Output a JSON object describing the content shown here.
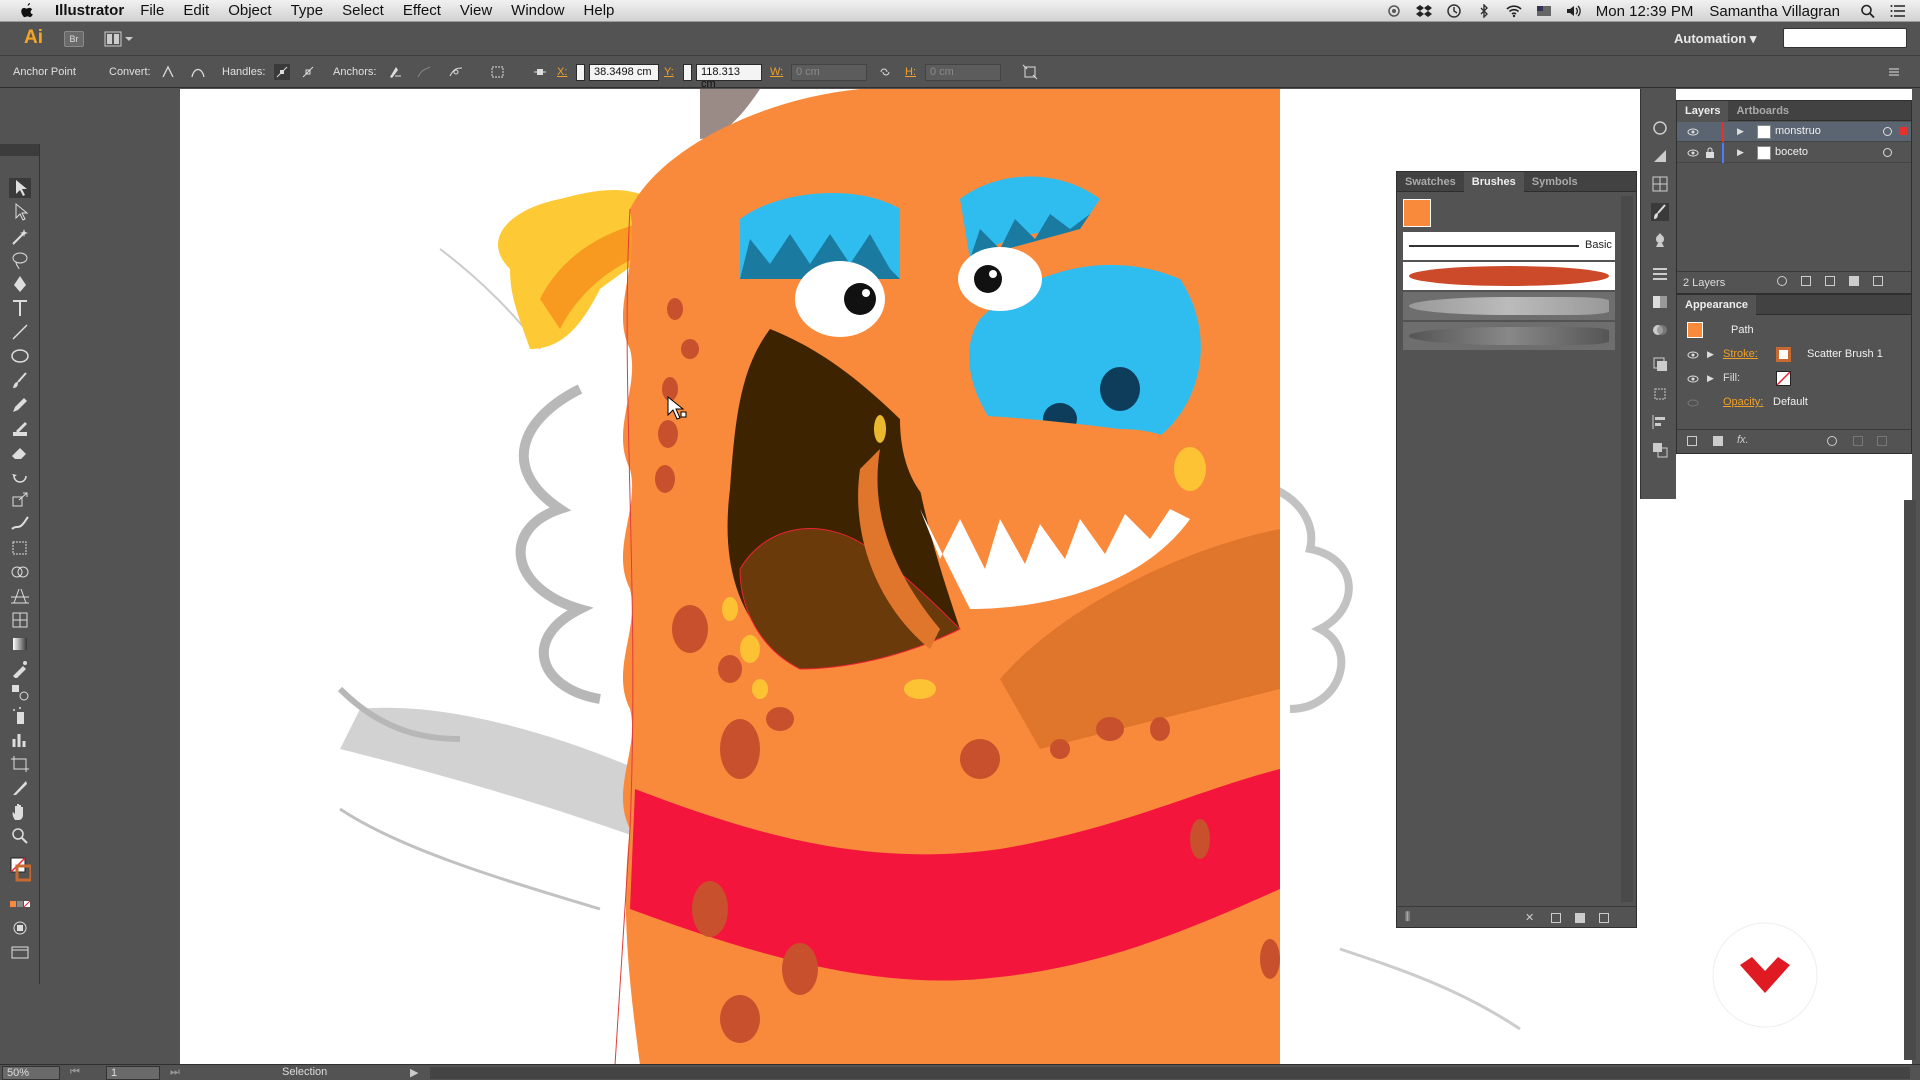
{
  "menubar": {
    "app_name": "Illustrator",
    "items": [
      "File",
      "Edit",
      "Object",
      "Type",
      "Select",
      "Effect",
      "View",
      "Window",
      "Help"
    ],
    "clock": "Mon 12:39 PM",
    "user": "Samantha Villagran"
  },
  "appbar": {
    "logo": "Ai",
    "bridge": "Br",
    "workspace": "Automation"
  },
  "controlbar": {
    "mode": "Anchor Point",
    "convert_label": "Convert:",
    "handles_label": "Handles:",
    "anchors_label": "Anchors:",
    "x_label": "X:",
    "x_value": "38.3498 cm",
    "y_label": "Y:",
    "y_value": "118.313 cm",
    "w_label": "W:",
    "w_value": "0 cm",
    "h_label": "H:",
    "h_value": "0 cm"
  },
  "layers_panel": {
    "tabs": [
      "Layers",
      "Artboards"
    ],
    "layers": [
      {
        "name": "monstruo",
        "color": "#e8302c"
      },
      {
        "name": "boceto",
        "color": "#4a7cff"
      }
    ],
    "count": "2 Layers"
  },
  "appearance_panel": {
    "title": "Appearance",
    "object": "Path",
    "stroke_label": "Stroke:",
    "stroke_value": "Scatter Brush 1",
    "fill_label": "Fill:",
    "opacity_label": "Opacity:",
    "opacity_value": "Default"
  },
  "brushes_panel": {
    "tabs": [
      "Swatches",
      "Brushes",
      "Symbols"
    ],
    "basic_label": "Basic"
  },
  "statusbar": {
    "zoom": "50%",
    "page": "1",
    "status": "Selection"
  },
  "colors": {
    "monster_orange": "#f98a3c",
    "brow_blue": "#1b7aa0",
    "nose_blue": "#2fbdf0",
    "mouth_dark": "#3e2300",
    "tongue": "#6a3a0a",
    "stripe_red": "#f4153d",
    "horn_yellow": "#fdc934",
    "spot_red": "#c9502c"
  }
}
